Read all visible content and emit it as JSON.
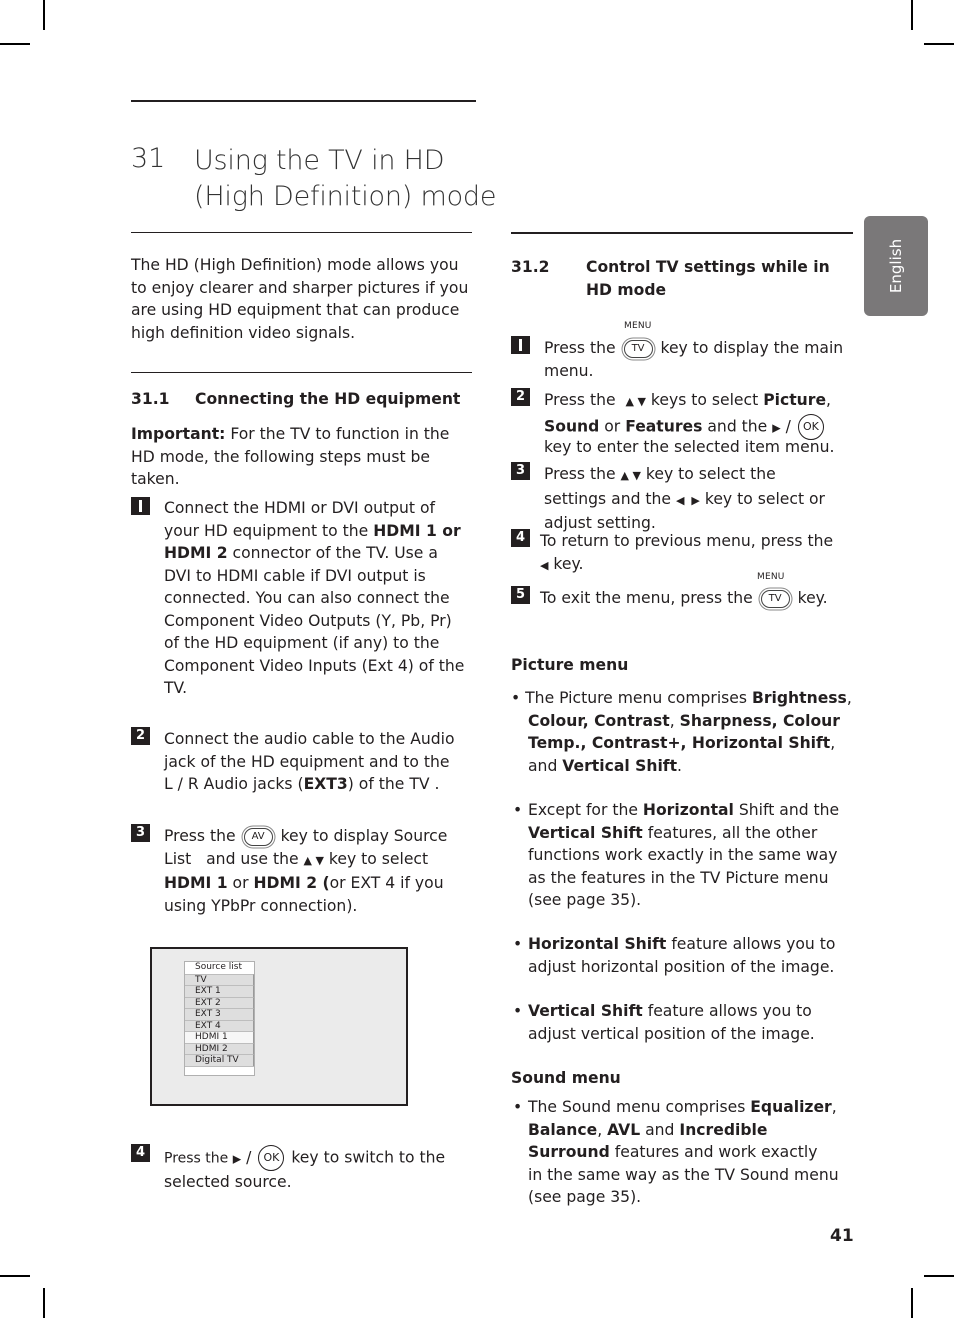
{
  "page": {
    "number": "41",
    "language_tab": "English"
  },
  "title": {
    "number": "31",
    "line1": "Using the TV in HD",
    "line2": "(High Definition) mode"
  },
  "intro": {
    "lines": [
      "The HD (High Definition) mode allows you",
      "to enjoy clearer and sharper pictures if you",
      "are using HD equipment that can produce",
      "high definition video signals."
    ]
  },
  "section1": {
    "number": "31.1",
    "title": "Connecting the HD equipment",
    "important_label": "Important:",
    "important_line1": " For the TV to function in the",
    "important_line2": "HD mode, the following steps must be taken.",
    "steps": [
      {
        "badge": "1",
        "lines": {
          "l1": "Connect the HDMI or DVI output of",
          "l2a": "your HD equipment to the ",
          "l2b": "HDMI 1 or",
          "l3a": "HDMI 2",
          "l3b": " connector of the TV. Use a",
          "l4": "DVI to HDMI cable if DVI output is",
          "l5": "connected. You can also connect the",
          "l6": "Component Video Outputs (Y, Pb, Pr)",
          "l7": "of the HD equipment (if any) to the",
          "l8": "Component Video Inputs (Ext 4) of the",
          "l9": "TV."
        }
      },
      {
        "badge": "2",
        "lines": {
          "l1": "Connect the audio cable to the Audio",
          "l2": "jack of the HD equipment and to the",
          "l3a": "L / R Audio jacks (",
          "l3b": "EXT3",
          "l3c": ") of the TV ."
        }
      },
      {
        "badge": "3",
        "lines": {
          "l1a": "Press the",
          "key": "AV",
          "l1b": "key to display Source",
          "l2a": "List   and use the ",
          "arrows": "▲ ▼",
          "l2b": " key to select",
          "l3a": "HDMI 1",
          "l3b": " or ",
          "l3c": "HDMI 2 (",
          "l3d": "or EXT 4 if you",
          "l4": "using YPbPr connection)."
        }
      },
      {
        "badge": "4",
        "lines": {
          "l1a": "Press the ",
          "arrow": "▶",
          "slash": " / ",
          "key": "OK",
          "l1b": " key to switch to the",
          "l2": "selected source."
        }
      }
    ],
    "source_list": {
      "header": "Source list",
      "items": [
        "TV",
        "EXT 1",
        "EXT 2",
        "EXT 3",
        "EXT 4",
        "HDMI 1",
        "HDMI 2",
        "Digital TV"
      ],
      "selected": "HDMI 1"
    }
  },
  "section2": {
    "number": "31.2",
    "title_line1": "Control TV settings while in",
    "title_line2": "HD mode",
    "steps": [
      {
        "badge": "1",
        "menu_label": "MENU",
        "key": "TV",
        "l1a": "Press the",
        "l1b": "key to display the main",
        "l2": "menu."
      },
      {
        "badge": "2",
        "l1a": "Press the  ",
        "arrows": "▲ ▼",
        "l1b": " keys to select ",
        "l1c": "Picture",
        "l1d": ",",
        "l2a": "Sound",
        "l2b": " or ",
        "l2c": "Features",
        "l2d": " and the ",
        "arrow": "▶",
        "slash": " / ",
        "key": "OK",
        "l3": "key to enter the selected item menu."
      },
      {
        "badge": "3",
        "l1a": "Press the ",
        "arrows": "▲ ▼",
        "l1b": " key to select the",
        "l2a": "settings and the ",
        "arrows2": "◀  ▶",
        "l2b": " key to select or",
        "l3": "adjust setting."
      },
      {
        "badge": "4",
        "l1": "To return to previous menu, press the",
        "arrow": "◀",
        "l2": " key."
      },
      {
        "badge": "5",
        "menu_label": "MENU",
        "key": "TV",
        "l1a": "To exit the menu, press the",
        "l1b": "key."
      }
    ],
    "picture_menu": {
      "heading": "Picture menu",
      "bullets": [
        {
          "l1a": "• The Picture menu comprises ",
          "l1b": "Brightness",
          "l1c": ",",
          "l2a": "Colour, Contrast",
          "l2b": ", ",
          "l2c": "Sharpness, Colour",
          "l3a": "Temp., Contrast+, Horizontal Shift",
          "l3b": ",",
          "l4a": "and ",
          "l4b": "Vertical Shift",
          "l4c": "."
        },
        {
          "marker": "•",
          "l1a": "Except for the ",
          "l1b": "Horizontal",
          "l1c": " Shift and the",
          "l2a": "Vertical Shift",
          "l2b": " features, all the other",
          "l3": "functions work exactly in the same way",
          "l4": "as the features in the TV Picture menu",
          "l5": "(see page 35)."
        },
        {
          "marker": "•",
          "l1a": "Horizontal Shift",
          "l1b": " feature allows you to",
          "l2": "adjust horizontal position of the image."
        },
        {
          "marker": "•",
          "l1a": "Vertical Shift",
          "l1b": " feature allows you to",
          "l2": "adjust vertical position of the image."
        }
      ]
    },
    "sound_menu": {
      "heading": "Sound menu",
      "bullet": {
        "marker": "•",
        "l1a": "The Sound menu comprises ",
        "l1b": "Equalizer",
        "l1c": ",",
        "l2a": "Balance",
        "l2b": ", ",
        "l2c": "AVL",
        "l2d": " and ",
        "l2e": "Incredible",
        "l3a": "Surround",
        "l3b": " features and work exactly",
        "l4": "in the same way as the TV Sound menu",
        "l5": "(see page 35)."
      }
    }
  }
}
